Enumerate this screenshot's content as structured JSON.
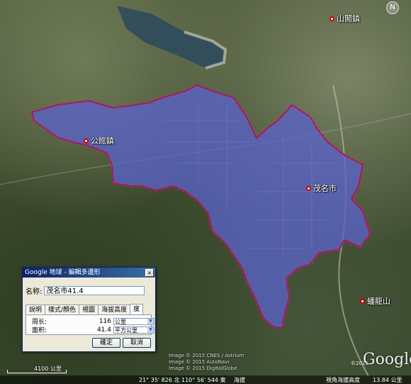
{
  "map": {
    "places": [
      {
        "name": "山閣鎮",
        "id": "shange"
      },
      {
        "name": "公館鎮",
        "id": "gongguan"
      },
      {
        "name": "茂名市",
        "id": "maoming"
      },
      {
        "name": "蟠龍山",
        "id": "panlong"
      }
    ],
    "compass_label": "N",
    "watermark": "Google",
    "watermark_year": "©2015",
    "copyright_lines": [
      "Image © 2015 CNES / Astrium",
      "Image © 2015 AutoNavi",
      "Image © 2015 DigitalGlobe"
    ],
    "scale_label": "4100 公里",
    "colors": {
      "polygon_fill": "#5a63c8",
      "polygon_outline": "#ff1a1a",
      "water": "#2f4d5c"
    }
  },
  "status_bar": {
    "latitude": "21° 35' 826 北",
    "longitude": "110° 56' 544 東",
    "elevation": "海拔",
    "view_label": "視角海拔高度",
    "view_value": "13.84 公里"
  },
  "dialog": {
    "title": "Google 地球 - 編輯多邊形",
    "close_label": "×",
    "name_label": "名称:",
    "name_value": "茂名市41.4",
    "tabs": [
      "說明",
      "樣式/顏色",
      "視圖",
      "海拔高度",
      "度"
    ],
    "active_tab": 4,
    "perimeter_label": "周长:",
    "perimeter_value": "116",
    "perimeter_unit": "公里",
    "area_label": "面积:",
    "area_value": "41.4",
    "area_unit": "平方公里",
    "ok_label": "確定",
    "cancel_label": "取消"
  }
}
